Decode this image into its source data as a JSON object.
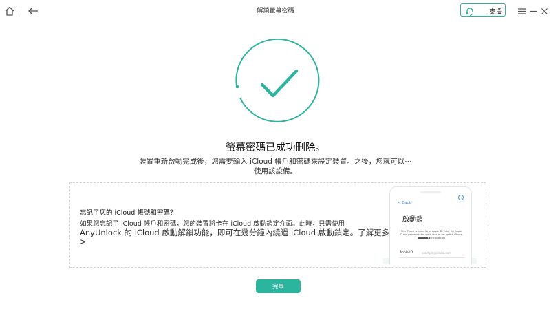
{
  "window": {
    "title": "解鎖螢幕密碼",
    "support_label": "支援"
  },
  "colors": {
    "accent": "#2bb59e"
  },
  "icons": {
    "home": "home-icon",
    "back": "back-arrow-icon",
    "support": "headset-icon",
    "menu": "menu-icon",
    "minimize": "minimize-icon",
    "close": "close-icon",
    "success": "checkmark-icon"
  },
  "main": {
    "headline": "螢幕密碼已成功刪除。",
    "description_line1": "裝置重新啟動完成後，您需要輸入 iCloud 帳戶和密碼來設定裝置。之後，您就可以⋯",
    "description_line2": "使用該設備。"
  },
  "info": {
    "title": "忘記了您的 iCloud 帳號和密碼？",
    "line1": "如果您忘記了 iCloud 帳戶和密碼，您的裝置將卡在 iCloud 啟動鎖定介面。此時，只需使用",
    "line2": "AnyUnlock 的 iCloud 啟動解鎖功能，即可在幾分鐘內繞過 iCloud 啟動鎖定。了解更多 >"
  },
  "phone": {
    "back_label": "< Back",
    "title": "啟動鎖",
    "text": "This iPhone is linked to an Apple ID. Enter the Apple ID and password that were used to set up this iPhone. j●●●●●●@icloud.com",
    "apple_id_label": "Apple ID",
    "email_placeholder": "example@icloud.com"
  },
  "actions": {
    "done_label": "完畢"
  }
}
